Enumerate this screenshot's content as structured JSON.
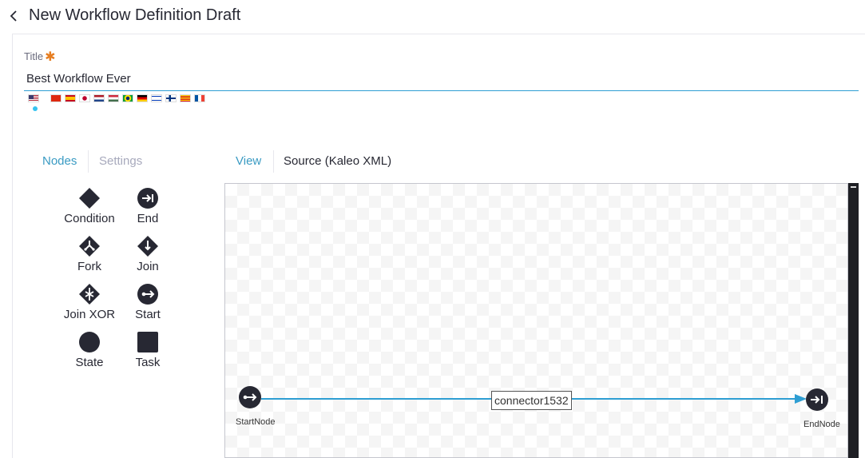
{
  "header": {
    "title": "New Workflow Definition Draft"
  },
  "form": {
    "title_label": "Title",
    "title_value": "Best Workflow Ever"
  },
  "flags": [
    "en_US",
    "zh_CN",
    "es_ES",
    "ja_JP",
    "nl_NL",
    "hu_HU",
    "pt_BR",
    "de_DE",
    "iw_IL",
    "fi_FI",
    "ca_ES",
    "fr_FR"
  ],
  "tabs": {
    "nodes": "Nodes",
    "settings": "Settings",
    "view": "View",
    "source": "Source (Kaleo XML)"
  },
  "palette": {
    "condition": "Condition",
    "end": "End",
    "fork": "Fork",
    "join": "Join",
    "join_xor": "Join XOR",
    "start": "Start",
    "state": "State",
    "task": "Task"
  },
  "diagram": {
    "start_node": "StartNode",
    "end_node": "EndNode",
    "connector": "connector1532",
    "connector_color": "#2e9ed3",
    "node_color": "#272833"
  }
}
